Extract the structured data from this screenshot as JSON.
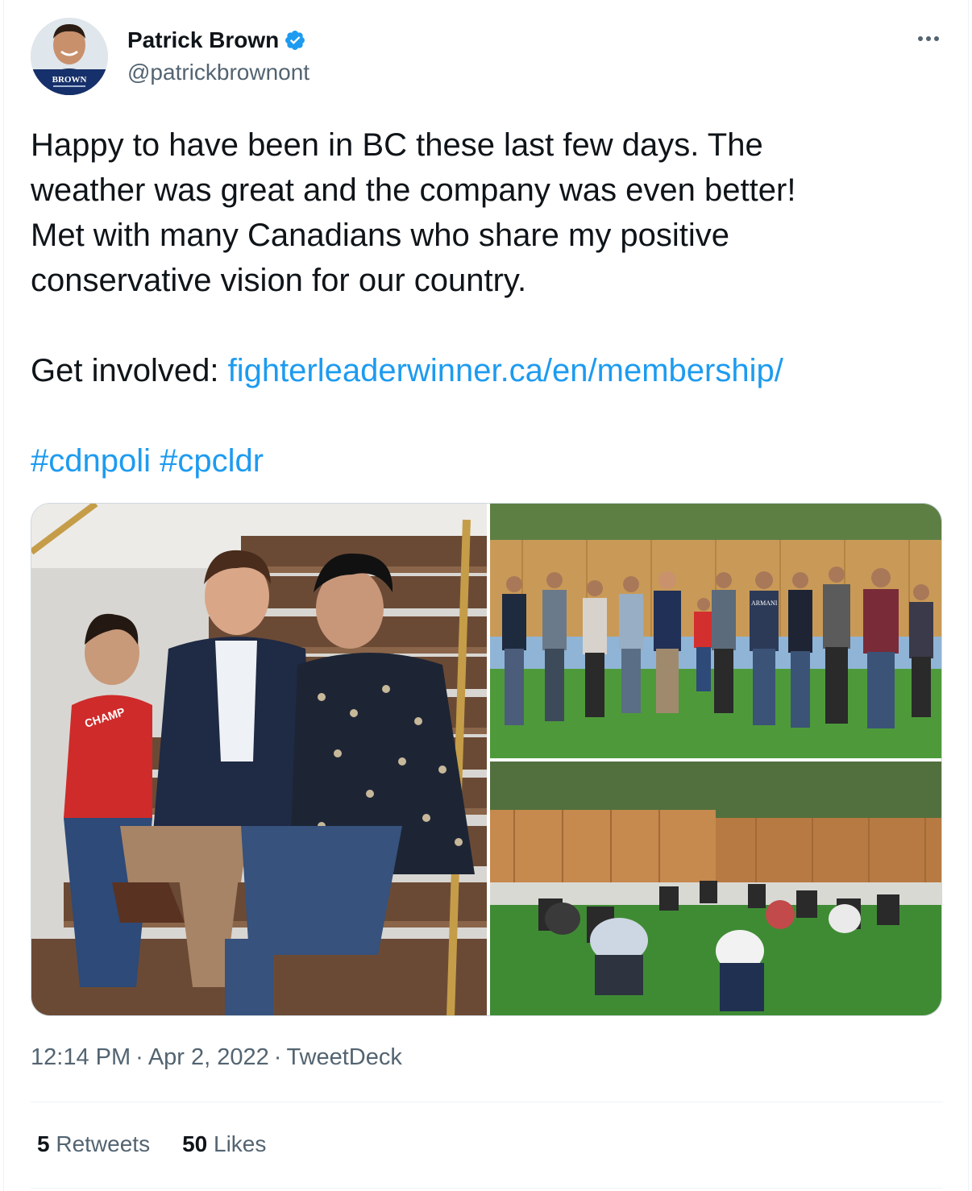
{
  "author": {
    "name": "Patrick Brown",
    "handle": "@patrickbrownont",
    "avatar_badge": "BROWN",
    "verified_icon": "verified-badge-icon",
    "colors": {
      "verified": "#1d9bf0",
      "avatar_banner": "#16306b"
    }
  },
  "tweet": {
    "line1": "Happy to have been in BC these last few days. The\nweather was great and the company was even better!\nMet with many Canadians who share my positive\nconservative vision for our country.\n\n",
    "get_involved_label": "Get involved: ",
    "link": "fighterleaderwinner.ca/en/membership/",
    "hashtag1": "#cdnpoli",
    "hashtag2": "#cpcldr"
  },
  "media": {
    "images": [
      "photo-stairs",
      "photo-group",
      "photo-backyard-meeting"
    ],
    "shirt_text": "CHAMP",
    "sweater_text": "ARMANI"
  },
  "meta": {
    "time": "12:14 PM",
    "date": "Apr 2, 2022",
    "source": "TweetDeck",
    "separator": "·"
  },
  "stats": {
    "retweets_count": "5",
    "retweets_label": "Retweets",
    "likes_count": "50",
    "likes_label": "Likes"
  },
  "colors": {
    "link": "#1d9bf0",
    "secondary_text": "#536471",
    "primary_text": "#0f1419"
  }
}
